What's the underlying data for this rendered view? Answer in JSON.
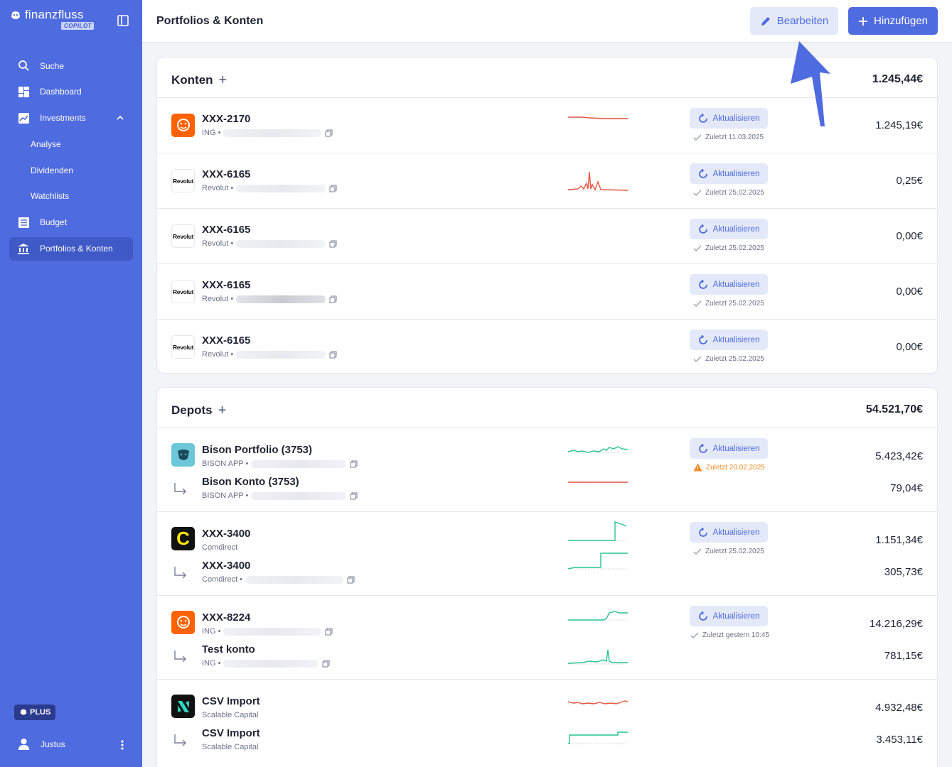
{
  "brand": {
    "name": "finanzfluss",
    "badge": "COPILOT"
  },
  "sidebar": {
    "items": [
      {
        "label": "Suche",
        "icon": "search-icon"
      },
      {
        "label": "Dashboard",
        "icon": "dashboard-icon"
      },
      {
        "label": "Investments",
        "icon": "chart-line-icon",
        "expanded": true
      },
      {
        "label": "Analyse",
        "sub": true
      },
      {
        "label": "Dividenden",
        "sub": true
      },
      {
        "label": "Watchlists",
        "sub": true
      },
      {
        "label": "Budget",
        "icon": "budget-icon"
      },
      {
        "label": "Portfolios & Konten",
        "icon": "bank-icon",
        "active": true
      }
    ],
    "plus_badge": "PLUS",
    "user": "Justus"
  },
  "topbar": {
    "title": "Portfolios & Konten",
    "edit_label": "Bearbeiten",
    "add_label": "Hinzufügen"
  },
  "refresh_label": "Aktualisieren",
  "konten": {
    "title": "Konten",
    "total": "1.245,44€",
    "rows": [
      {
        "name": "XXX-2170",
        "meta": "ING •",
        "last": "Zuletzt 11.03.2025",
        "amount": "1.245,19€",
        "logo": "ING"
      },
      {
        "name": "XXX-6165",
        "meta": "Revolut •",
        "last": "Zuletzt 25.02.2025",
        "amount": "0,25€",
        "logo": "Revolut"
      },
      {
        "name": "XXX-6165",
        "meta": "Revolut •",
        "last": "Zuletzt 25.02.2025",
        "amount": "0,00€",
        "logo": "Revolut"
      },
      {
        "name": "XXX-6165",
        "meta": "Revolut •",
        "last": "Zuletzt 25.02.2025",
        "amount": "0,00€",
        "logo": "Revolut"
      },
      {
        "name": "XXX-6165",
        "meta": "Revolut •",
        "last": "Zuletzt 25.02.2025",
        "amount": "0,00€",
        "logo": "Revolut"
      }
    ]
  },
  "depots": {
    "title": "Depots",
    "total": "54.521,70€",
    "groups": [
      {
        "main": {
          "name": "Bison Portfolio (3753)",
          "meta": "BISON APP •",
          "amount": "5.423,42€"
        },
        "sub": {
          "name": "Bison Konto (3753)",
          "meta": "BISON APP •",
          "amount": "79,04€"
        },
        "last": "Zuletzt 20.02.2025",
        "warn": true
      },
      {
        "main": {
          "name": "XXX-3400",
          "meta": "Comdirect",
          "amount": "1.151,34€"
        },
        "sub": {
          "name": "XXX-3400",
          "meta": "Comdirect •",
          "amount": "305,73€"
        },
        "last": "Zuletzt 25.02.2025",
        "logo_letter": "C"
      },
      {
        "main": {
          "name": "XXX-8224",
          "meta": "ING •",
          "amount": "14.216,29€"
        },
        "sub": {
          "name": "Test konto",
          "meta": "ING •",
          "amount": "781,15€"
        },
        "last": "Zuletzt gestern 10:45"
      },
      {
        "main": {
          "name": "CSV Import",
          "meta": "Scalable Capital",
          "amount": "4.932,48€"
        },
        "sub": {
          "name": "CSV Import",
          "meta": "Scalable Capital",
          "amount": "3.453,11€"
        }
      }
    ]
  },
  "colors": {
    "accent": "#4f6be0",
    "positive": "#22c58b",
    "negative": "#e8553e",
    "warning": "#f08a24"
  }
}
